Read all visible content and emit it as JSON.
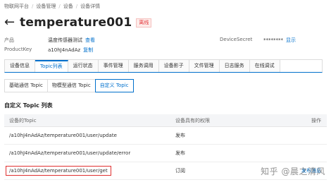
{
  "breadcrumb": [
    "物联网平台",
    "设备管理",
    "设备",
    "设备详情"
  ],
  "header": {
    "title": "temperature001",
    "status": "离线"
  },
  "info": {
    "product_label": "产品",
    "product_value": "温度传感器测试",
    "product_link": "查看",
    "productkey_label": "ProductKey",
    "productkey_value": "a10hJ4nAdAz",
    "productkey_link": "复制",
    "secret_label": "DeviceSecret",
    "secret_value": "********",
    "secret_link": "显示"
  },
  "main_tabs": [
    "设备信息",
    "Topic列表",
    "运行状态",
    "事件管理",
    "服务调用",
    "设备影子",
    "文件管理",
    "日志服务",
    "在线调试"
  ],
  "sub_tabs": [
    "基础通信 Topic",
    "物模型通信 Topic",
    "自定义 Topic"
  ],
  "section_title": "自定义 Topic 列表",
  "table": {
    "headers": [
      "设备的Topic",
      "设备具有的权限",
      "操作"
    ],
    "rows": [
      {
        "topic": "/a10hJ4nAdAz/temperature001/user/update",
        "permission": "发布",
        "action": ""
      },
      {
        "topic": "/a10hJ4nAdAz/temperature001/user/update/error",
        "permission": "发布",
        "action": ""
      },
      {
        "topic": "/a10hJ4nAdAz/temperature001/user/get",
        "permission": "订阅",
        "action": "发布消息"
      }
    ]
  },
  "watermark": "知乎 @晨之清风",
  "colors": {
    "accent": "#0070cc",
    "offline": "#e4393c",
    "highlight": "#e03030"
  }
}
